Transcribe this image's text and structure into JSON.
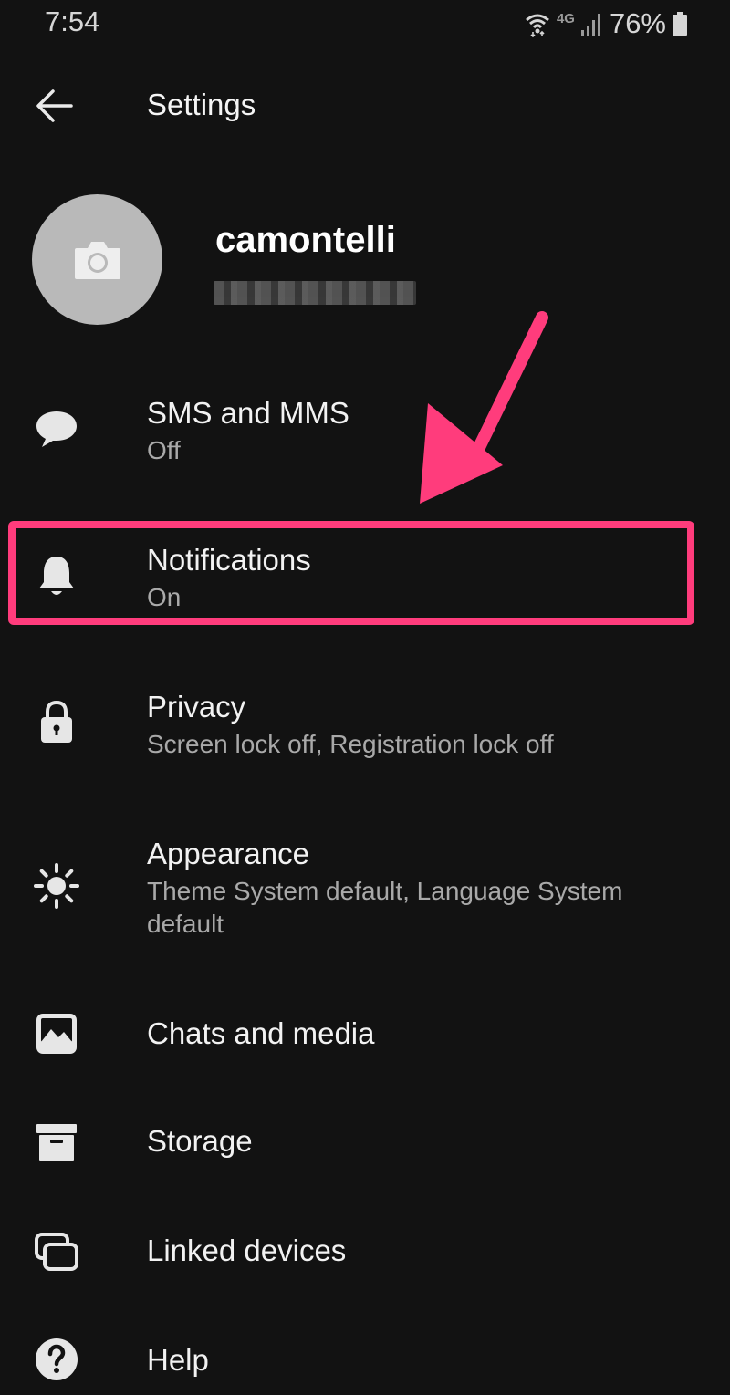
{
  "status_bar": {
    "time": "7:54",
    "network_label": "4G",
    "battery": "76%",
    "icons": [
      "wifi-icon",
      "signal-icon",
      "battery-icon"
    ]
  },
  "header": {
    "title": "Settings",
    "back_icon": "arrow-left-icon"
  },
  "profile": {
    "name": "camontelli",
    "avatar_icon": "camera-icon"
  },
  "settings": {
    "items": [
      {
        "title": "SMS and MMS",
        "subtitle": "Off",
        "icon": "chat-bubble-icon"
      },
      {
        "title": "Notifications",
        "subtitle": "On",
        "icon": "bell-icon"
      },
      {
        "title": "Privacy",
        "subtitle": "Screen lock off, Registration lock off",
        "icon": "lock-icon"
      },
      {
        "title": "Appearance",
        "subtitle": "Theme System default, Language System default",
        "icon": "sun-icon"
      },
      {
        "title": "Chats and media",
        "subtitle": "",
        "icon": "image-icon"
      },
      {
        "title": "Storage",
        "subtitle": "",
        "icon": "archive-icon"
      },
      {
        "title": "Linked devices",
        "subtitle": "",
        "icon": "devices-icon"
      },
      {
        "title": "Help",
        "subtitle": "",
        "icon": "help-icon"
      }
    ]
  },
  "annotation": {
    "color": "#ff3c7c",
    "highlighted_item": "Notifications"
  },
  "colors": {
    "background": "#121212",
    "text_primary": "#f2f2f2",
    "text_secondary": "#a9a9a9",
    "avatar_bg": "#b9b9b9"
  }
}
